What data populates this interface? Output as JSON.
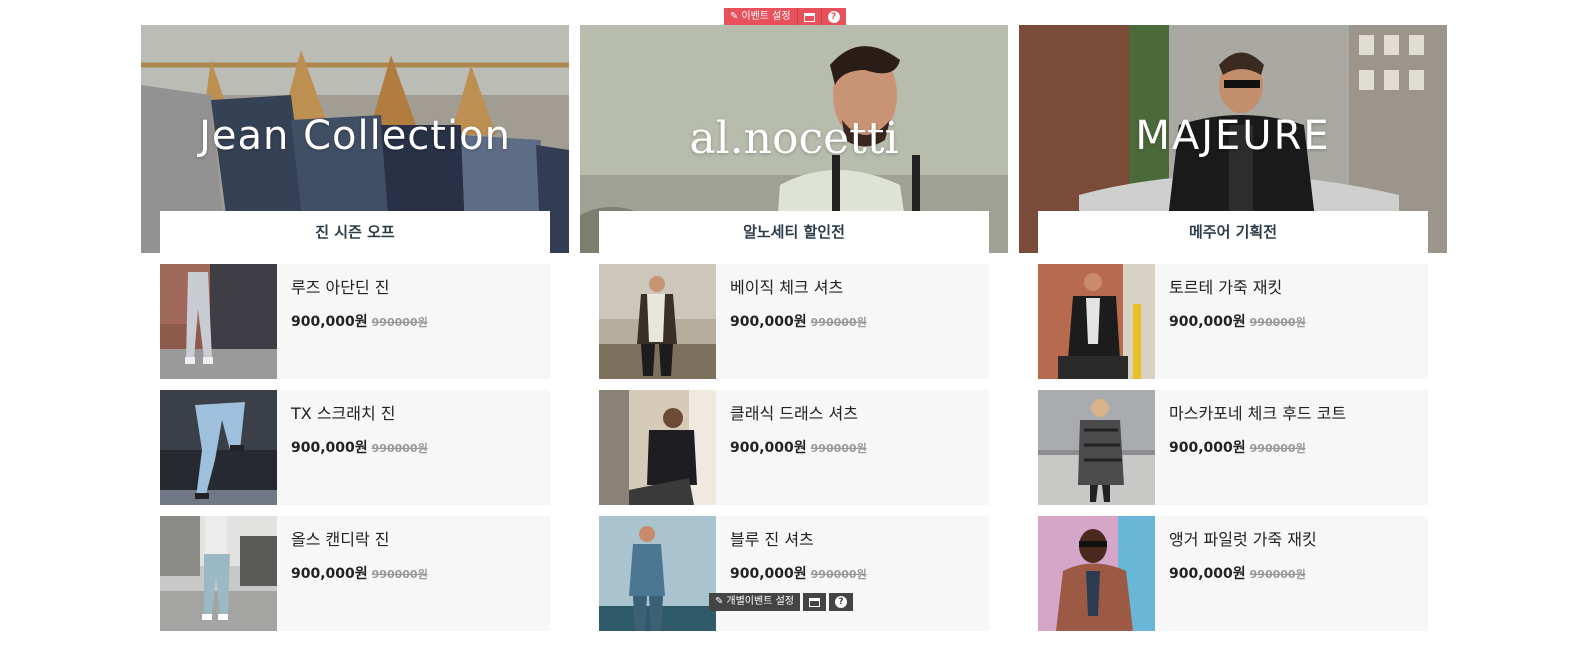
{
  "admin_toolbar": {
    "event_settings_label": "이벤트 설정",
    "edit_icon": "edit-icon",
    "window_icon": "window-icon",
    "help_icon": "help-icon",
    "accent": "#e8505b"
  },
  "columns": [
    {
      "brand": "Jean Collection",
      "label": "진 시즌 오프",
      "items": [
        {
          "name": "루즈 아단딘 진",
          "price": "900,000원",
          "original_price": "990000원"
        },
        {
          "name": "TX 스크래치 진",
          "price": "900,000원",
          "original_price": "990000원"
        },
        {
          "name": "올스 캔디락 진",
          "price": "900,000원",
          "original_price": "990000원"
        }
      ]
    },
    {
      "brand": "al.nocetti",
      "label": "알노세티 할인전",
      "items": [
        {
          "name": "베이직 체크 셔츠",
          "price": "900,000원",
          "original_price": "990000원"
        },
        {
          "name": "클래식 드래스 셔츠",
          "price": "900,000원",
          "original_price": "990000원"
        },
        {
          "name": "블루 진 셔츠",
          "price": "900,000원",
          "original_price": "990000원"
        }
      ]
    },
    {
      "brand": "MAJEURE",
      "label": "메주어 기획전",
      "items": [
        {
          "name": "토르테 가죽 재킷",
          "price": "900,000원",
          "original_price": "990000원"
        },
        {
          "name": "마스카포네 체크 후드 코트",
          "price": "900,000원",
          "original_price": "990000원"
        },
        {
          "name": "앵거 파일럿 가죽 재킷",
          "price": "900,000원",
          "original_price": "990000원"
        }
      ]
    }
  ],
  "item_toolbar": {
    "individual_event_settings_label": "개별이벤트 설정"
  }
}
